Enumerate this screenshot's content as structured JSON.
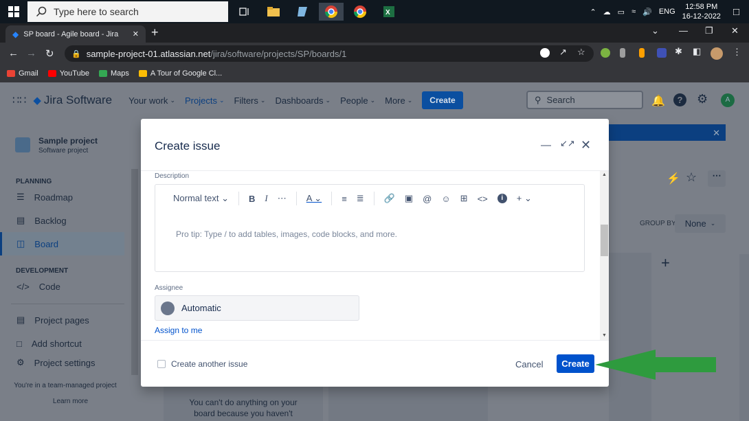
{
  "taskbar": {
    "search_placeholder": "Type here to search",
    "lang": "ENG",
    "time": "12:58 PM",
    "date": "16-12-2022"
  },
  "browser": {
    "tab_title": "SP board - Agile board - Jira",
    "url_host": "sample-project-01.atlassian.net",
    "url_path": "/jira/software/projects/SP/boards/1",
    "bookmarks": [
      "Gmail",
      "YouTube",
      "Maps",
      "A Tour of Google Cl..."
    ]
  },
  "jira": {
    "product": "Jira Software",
    "nav": [
      "Your work",
      "Projects",
      "Filters",
      "Dashboards",
      "People",
      "More"
    ],
    "create_label": "Create",
    "search_placeholder": "Search",
    "avatar_initial": "A"
  },
  "sidebar": {
    "project_name": "Sample project",
    "project_type": "Software project",
    "planning_label": "PLANNING",
    "planning_items": [
      "Roadmap",
      "Backlog",
      "Board"
    ],
    "development_label": "DEVELOPMENT",
    "development_items": [
      "Code"
    ],
    "other_items": [
      "Project pages",
      "Add shortcut",
      "Project settings"
    ],
    "footer_text": "You're in a team-managed project",
    "learn_more": "Learn more"
  },
  "board": {
    "group_by_label": "GROUP BY",
    "group_by_value": "None",
    "empty_text_1": "You can't do anything on your",
    "empty_text_2": "board because you haven't"
  },
  "modal": {
    "title": "Create issue",
    "description_label": "Description",
    "text_style": "Normal text",
    "editor_placeholder": "Pro tip: Type / to add tables, images, code blocks, and more.",
    "assignee_label": "Assignee",
    "assignee_value": "Automatic",
    "assign_to_me": "Assign to me",
    "create_another": "Create another issue",
    "cancel_label": "Cancel",
    "create_label": "Create"
  },
  "colors": {
    "jira_blue": "#0052cc",
    "arrow_green": "#2e9b3e",
    "overlay": "#7a7f88"
  }
}
